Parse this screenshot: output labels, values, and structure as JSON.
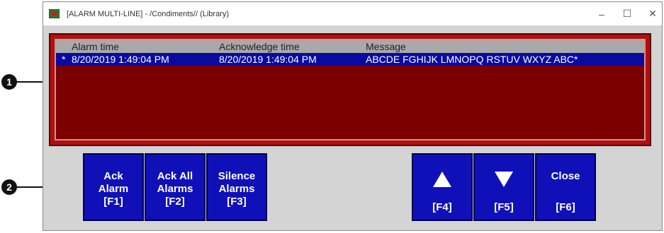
{
  "callouts": [
    "1",
    "2"
  ],
  "window": {
    "title": "[ALARM MULTI-LINE] - /Condiments// (Library)",
    "controls": {
      "minimize": "–",
      "maximize": "☐",
      "close": "✕"
    }
  },
  "alarm_table": {
    "columns": [
      "Alarm time",
      "Acknowledge time",
      "Message"
    ],
    "rows": [
      {
        "marker": "*",
        "alarm_time": "8/20/2019 1:49:04 PM",
        "ack_time": "8/20/2019 1:49:04 PM",
        "message": "ABCDE FGHIJK LMNOPQ RSTUV WXYZ ABC*"
      }
    ]
  },
  "buttons": {
    "ack_alarm": {
      "line1": "Ack",
      "line2": "Alarm",
      "key": "[F1]"
    },
    "ack_all": {
      "line1": "Ack All",
      "line2": "Alarms",
      "key": "[F2]"
    },
    "silence": {
      "line1": "Silence",
      "line2": "Alarms",
      "key": "[F3]"
    },
    "up": {
      "icon": "arrow-up-icon",
      "key": "[F4]"
    },
    "down": {
      "icon": "arrow-down-icon",
      "key": "[F5]"
    },
    "close": {
      "line1": "Close",
      "key": "[F6]"
    }
  },
  "colors": {
    "panel_red": "#b01010",
    "panel_inner": "#7a0000",
    "selected_row": "#0a0aa0",
    "button_blue": "#1010b8"
  }
}
